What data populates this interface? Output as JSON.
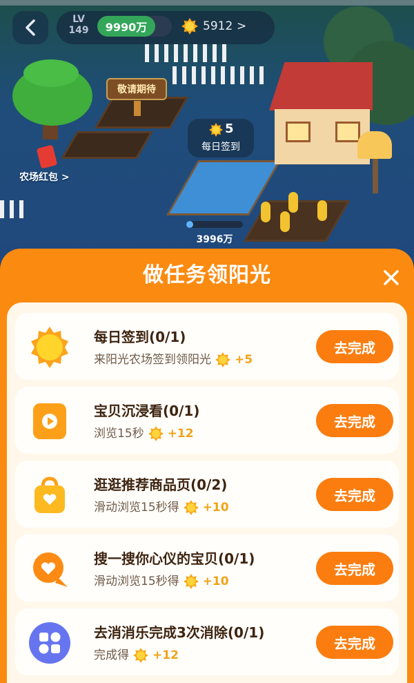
{
  "header": {
    "level_label": "LV",
    "level_value": "149",
    "money": "9990万",
    "coins": "5912",
    "coins_chevron": ">"
  },
  "game": {
    "coming_soon": "敬请期待",
    "daily_count": "5",
    "daily_label": "每日签到",
    "farm_red_packet": "农场红包 >",
    "crop_progress_text": "3996万",
    "crop_progress_fraction": 0.12
  },
  "panel": {
    "title": "做任务领阳光",
    "close_icon": "close-icon"
  },
  "tasks": [
    {
      "icon": "sun-icon",
      "title": "每日签到(0/1)",
      "desc": "来阳光农场签到领阳光",
      "reward": "+5",
      "button": "去完成"
    },
    {
      "icon": "video-play-icon",
      "title": "宝贝沉浸看(0/1)",
      "desc": "浏览15秒",
      "reward": "+12",
      "button": "去完成"
    },
    {
      "icon": "shopping-bag-heart-icon",
      "title": "逛逛推荐商品页(0/2)",
      "desc": "滑动浏览15秒得",
      "reward": "+10",
      "button": "去完成"
    },
    {
      "icon": "search-heart-icon",
      "title": "搜一搜你心仪的宝贝(0/1)",
      "desc": "滑动浏览15秒得",
      "reward": "+10",
      "button": "去完成"
    },
    {
      "icon": "game-grid-icon",
      "title": "去消消乐完成3次消除(0/1)",
      "desc": "完成得",
      "reward": "+12",
      "button": "去完成"
    }
  ],
  "colors": {
    "panel_orange": "#fb8a10",
    "button_orange": "#fb7d0f",
    "reward_gold": "#f0a319",
    "title_brown": "#3e2410"
  }
}
